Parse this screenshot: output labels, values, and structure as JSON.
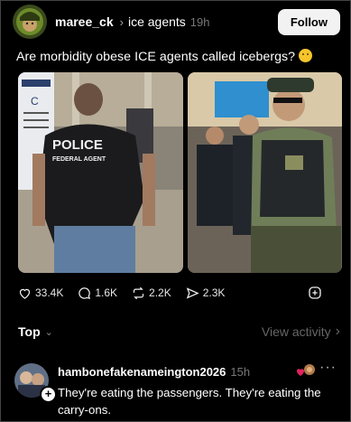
{
  "post": {
    "username": "maree_ck",
    "community": "ice agents",
    "time": "19h",
    "follow_label": "Follow",
    "text": "Are morbidity obese ICE agents called icebergs?",
    "emoji": "thinking-face-icon"
  },
  "images": {
    "left": {
      "vest_text_1": "POLICE",
      "vest_text_2": "FEDERAL AGENT",
      "sign_letter": "C"
    }
  },
  "actions": {
    "likes": "33.4K",
    "comments": "1.6K",
    "reposts": "2.2K",
    "shares": "2.3K"
  },
  "comments_bar": {
    "sort_label": "Top",
    "view_activity_label": "View activity"
  },
  "comment": {
    "username": "hambonefakenameington2026",
    "time": "15h",
    "text": "They're eating the passengers. They're eating the carry-ons."
  },
  "colors": {
    "background": "#000000",
    "follow_bg": "#f2f2f2",
    "muted": "#777777"
  }
}
